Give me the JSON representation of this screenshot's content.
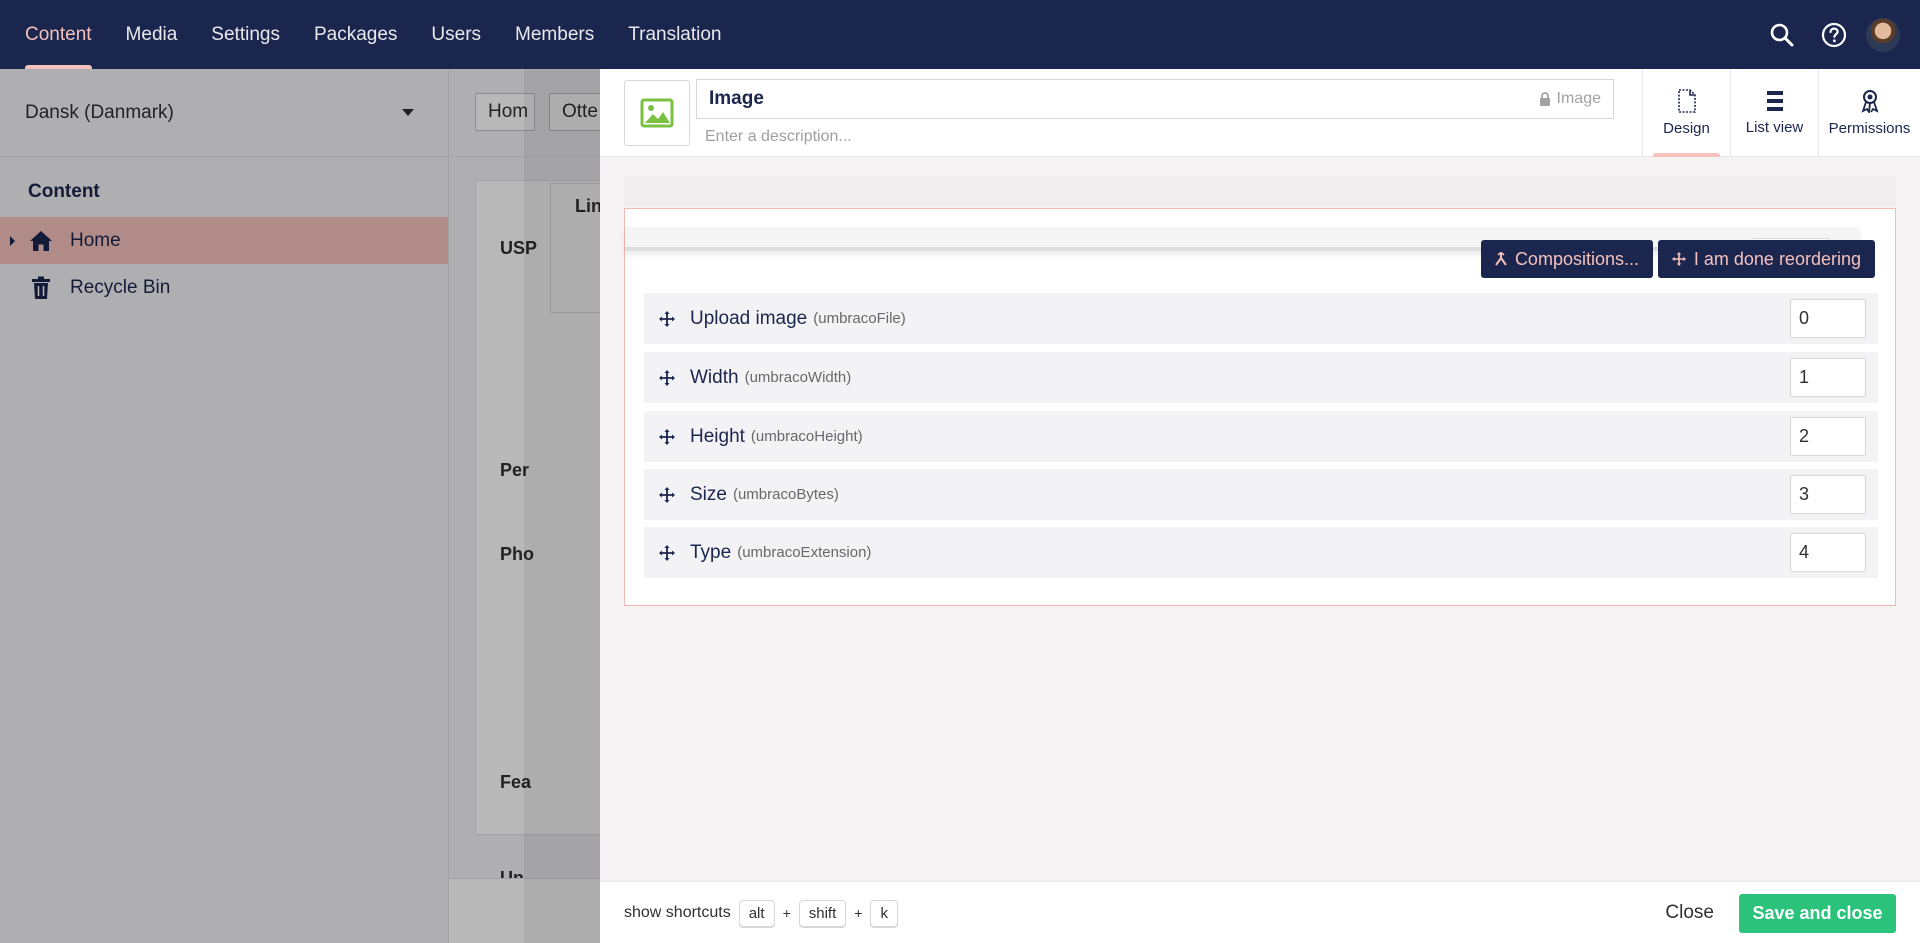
{
  "topnav": {
    "items": [
      {
        "label": "Content",
        "active": true
      },
      {
        "label": "Media"
      },
      {
        "label": "Settings"
      },
      {
        "label": "Packages"
      },
      {
        "label": "Users"
      },
      {
        "label": "Members"
      },
      {
        "label": "Translation"
      }
    ],
    "right_icons": [
      "search-icon",
      "help-icon",
      "avatar"
    ]
  },
  "tree": {
    "language": "Dansk (Danmark)",
    "heading": "Content",
    "items": [
      {
        "label": "Home",
        "icon": "home-icon",
        "active": true
      },
      {
        "label": "Recycle Bin",
        "icon": "trash-icon"
      }
    ]
  },
  "background_editor": {
    "tab1": "Hom",
    "tab2": "Otte",
    "labels": [
      "USP",
      "Per",
      "Pho",
      "Fea",
      "Un",
      "Lin"
    ]
  },
  "editor": {
    "icon": "picture-icon",
    "name": "Image",
    "alias": "Image",
    "description_placeholder": "Enter a description...",
    "apps": [
      {
        "label": "Design",
        "icon": "document-icon",
        "active": true
      },
      {
        "label": "List view",
        "icon": "list-icon"
      },
      {
        "label": "Permissions",
        "icon": "permissions-icon"
      }
    ],
    "compositions_label": "Compositions...",
    "done_reordering_label": "I am done reordering",
    "properties": [
      {
        "label": "Upload image",
        "alias": "(umbracoFile)",
        "sort": "0"
      },
      {
        "label": "Width",
        "alias": "(umbracoWidth)",
        "sort": "1"
      },
      {
        "label": "Height",
        "alias": "(umbracoHeight)",
        "sort": "2"
      },
      {
        "label": "Size",
        "alias": "(umbracoBytes)",
        "sort": "3"
      },
      {
        "label": "Type",
        "alias": "(umbracoExtension)",
        "sort": "4"
      }
    ]
  },
  "footer": {
    "show_shortcuts": "show shortcuts",
    "keys": [
      "alt",
      "shift",
      "k"
    ],
    "plus": "+",
    "close_label": "Close",
    "save_label": "Save and close"
  },
  "colors": {
    "topbar": "#1b264f",
    "accent": "#f5c1bc",
    "save": "#2bc37c",
    "image_icon": "#7ac142"
  }
}
